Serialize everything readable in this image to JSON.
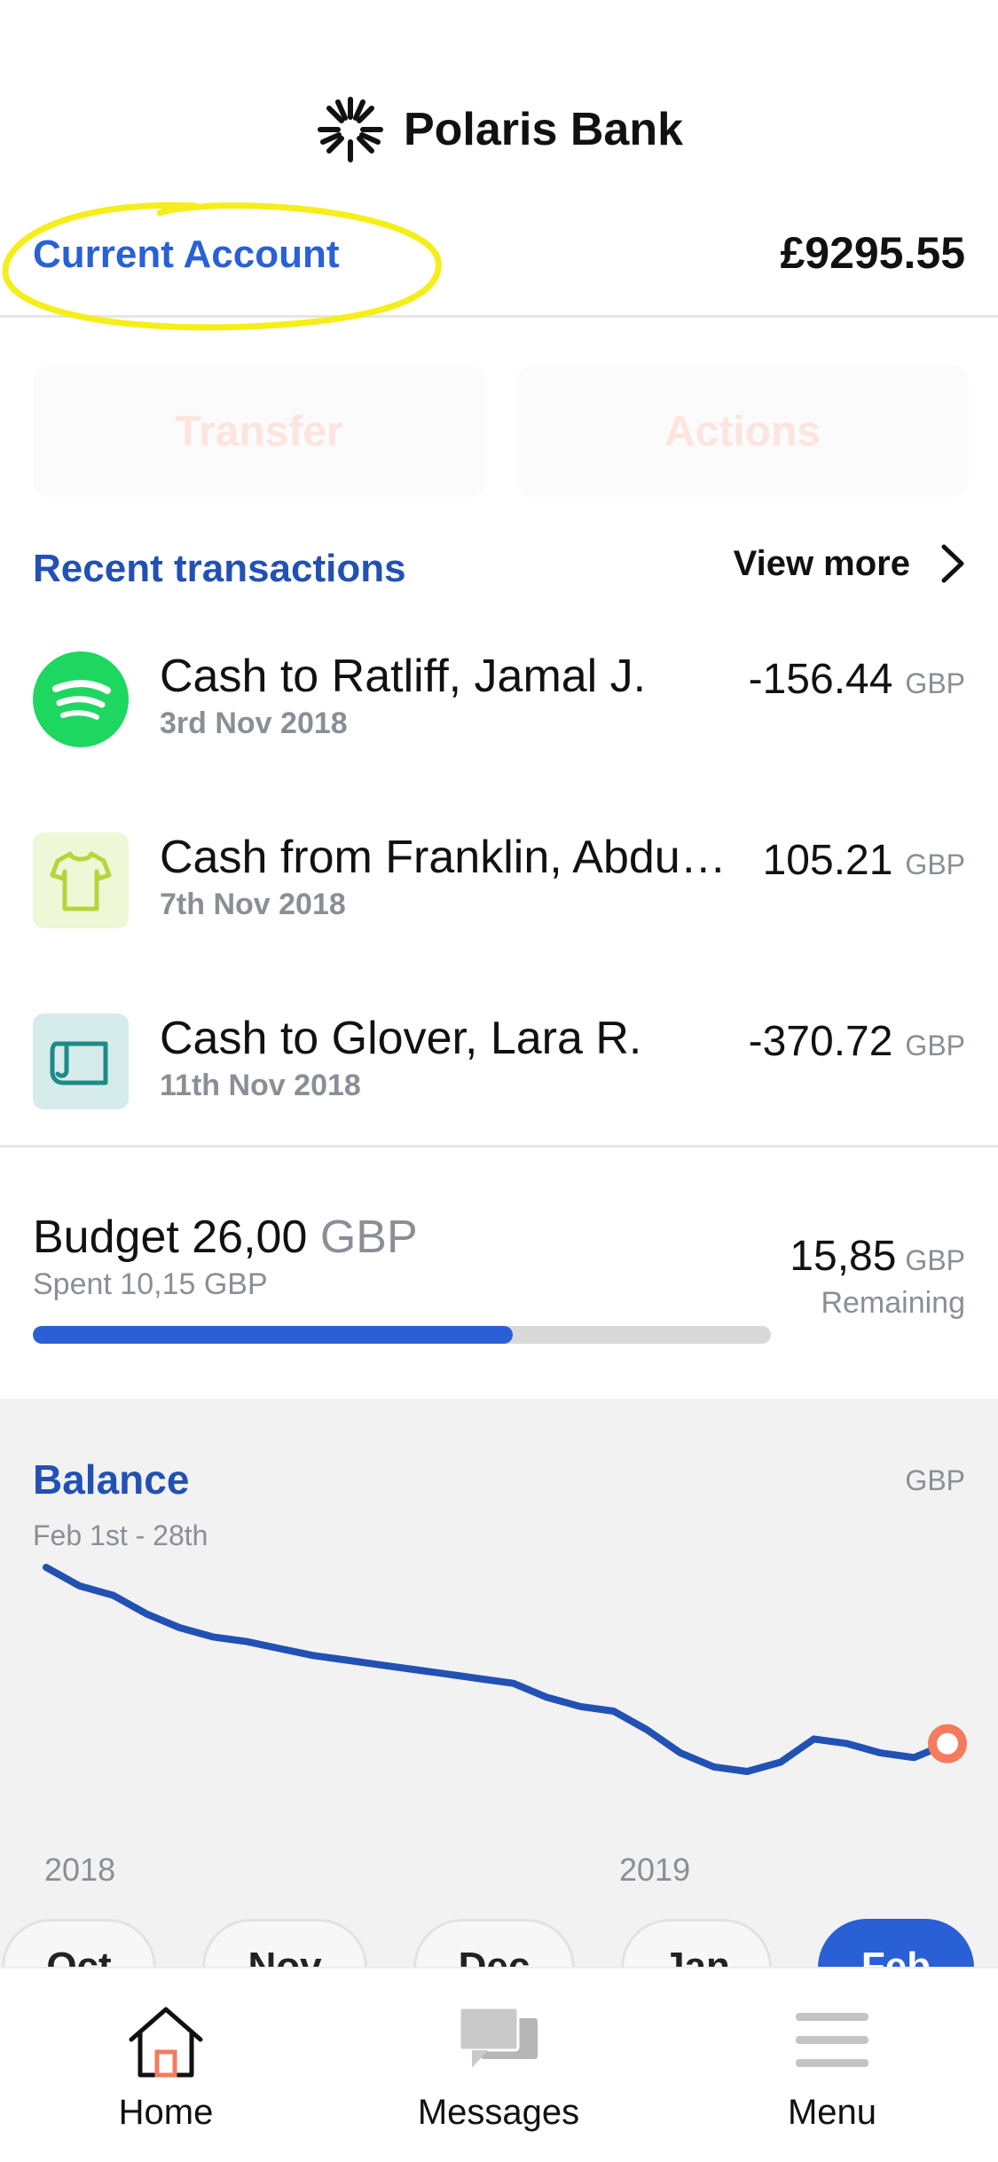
{
  "header": {
    "brand": "Polaris Bank",
    "account_label": "Current Account",
    "account_balance": "£9295.55"
  },
  "actions": {
    "transfer_label": "Transfer",
    "actions_label": "Actions"
  },
  "recent": {
    "title": "Recent transactions",
    "view_more": "View more",
    "items": [
      {
        "name": "Cash to Ratliff, Jamal J.",
        "date": "3rd Nov 2018",
        "amount": "-156.44",
        "currency": "GBP",
        "icon": "spotify-icon"
      },
      {
        "name": "Cash from Franklin, Abdu…",
        "date": "7th Nov 2018",
        "amount": "105.21",
        "currency": "GBP",
        "icon": "tshirt-icon"
      },
      {
        "name": "Cash to Glover, Lara R.",
        "date": "11th Nov 2018",
        "amount": "-370.72",
        "currency": "GBP",
        "icon": "ticket-icon"
      }
    ]
  },
  "budget": {
    "title_prefix": "Budget 26,00",
    "title_currency": "GBP",
    "spent": "Spent 10,15 GBP",
    "remaining_amount": "15,85",
    "remaining_currency": "GBP",
    "remaining_label": "Remaining",
    "progress_fraction": 0.65
  },
  "balance": {
    "title": "Balance",
    "currency": "GBP",
    "range": "Feb 1st - 28th",
    "years": [
      "2018",
      "2019"
    ],
    "months": [
      "Oct",
      "Nov",
      "Dec",
      "Jan",
      "Feb"
    ],
    "active_month": "Feb"
  },
  "chart_data": {
    "type": "line",
    "title": "",
    "xlabel": "",
    "ylabel": "",
    "x": [
      1,
      2,
      3,
      4,
      5,
      6,
      7,
      8,
      9,
      10,
      11,
      12,
      13,
      14,
      15,
      16,
      17,
      18,
      19,
      20,
      21,
      22,
      23,
      24,
      25,
      26,
      27,
      28
    ],
    "values": [
      100,
      92,
      88,
      80,
      74,
      70,
      68,
      65,
      62,
      60,
      58,
      56,
      54,
      52,
      50,
      44,
      40,
      38,
      30,
      20,
      14,
      12,
      16,
      26,
      24,
      20,
      18,
      24
    ],
    "grid": false,
    "last_point_marker": true
  },
  "colors": {
    "brand_blue": "#2a60d6",
    "title_blue": "#2251b4",
    "line_blue": "#2251b4",
    "marker": "#f47b5e",
    "highlight": "#f5ee1b",
    "muted": "#8a8f96"
  },
  "tabbar": {
    "home": "Home",
    "messages": "Messages",
    "menu": "Menu"
  }
}
